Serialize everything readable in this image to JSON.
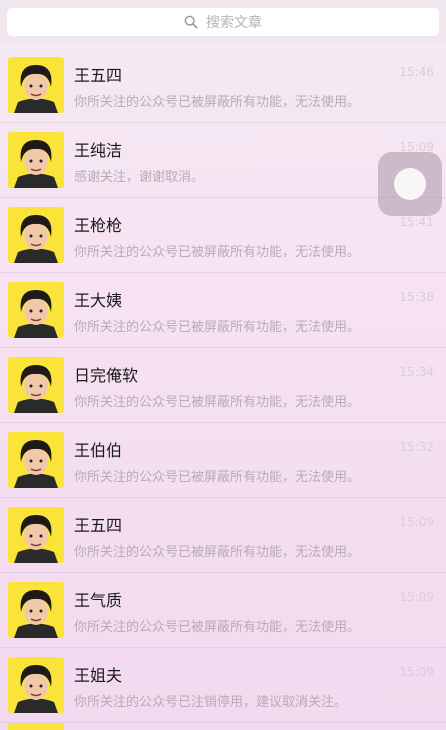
{
  "search": {
    "placeholder": "搜索文章"
  },
  "chats": [
    {
      "name": "王五四",
      "time": "15:46",
      "preview": "你所关注的公众号已被屏蔽所有功能，无法使用。"
    },
    {
      "name": "王纯洁",
      "time": "15:09",
      "preview": "感谢关注，谢谢取消。"
    },
    {
      "name": "王枪枪",
      "time": "15:41",
      "preview": "你所关注的公众号已被屏蔽所有功能，无法使用。"
    },
    {
      "name": "王大姨",
      "time": "15:38",
      "preview": "你所关注的公众号已被屏蔽所有功能，无法使用。"
    },
    {
      "name": "日完俺软",
      "time": "15:34",
      "preview": "你所关注的公众号已被屏蔽所有功能，无法使用。"
    },
    {
      "name": "王伯伯",
      "time": "15:32",
      "preview": "你所关注的公众号已被屏蔽所有功能，无法使用。"
    },
    {
      "name": "王五四",
      "time": "15:09",
      "preview": "你所关注的公众号已被屏蔽所有功能，无法使用。"
    },
    {
      "name": "王气质",
      "time": "15:09",
      "preview": "你所关注的公众号已被屏蔽所有功能，无法使用。"
    },
    {
      "name": "王姐夫",
      "time": "15:09",
      "preview": "你所关注的公众号已注销停用，建议取消关注。"
    }
  ],
  "colors": {
    "avatar_bg": "#fbe43a",
    "name": "#1b1b1b",
    "preview": "#b7acb4",
    "time": "#d9cfd6"
  },
  "icons": {
    "search": "search-icon",
    "avatar": "avatar-portrait",
    "floating": "assistive-touch-button"
  }
}
